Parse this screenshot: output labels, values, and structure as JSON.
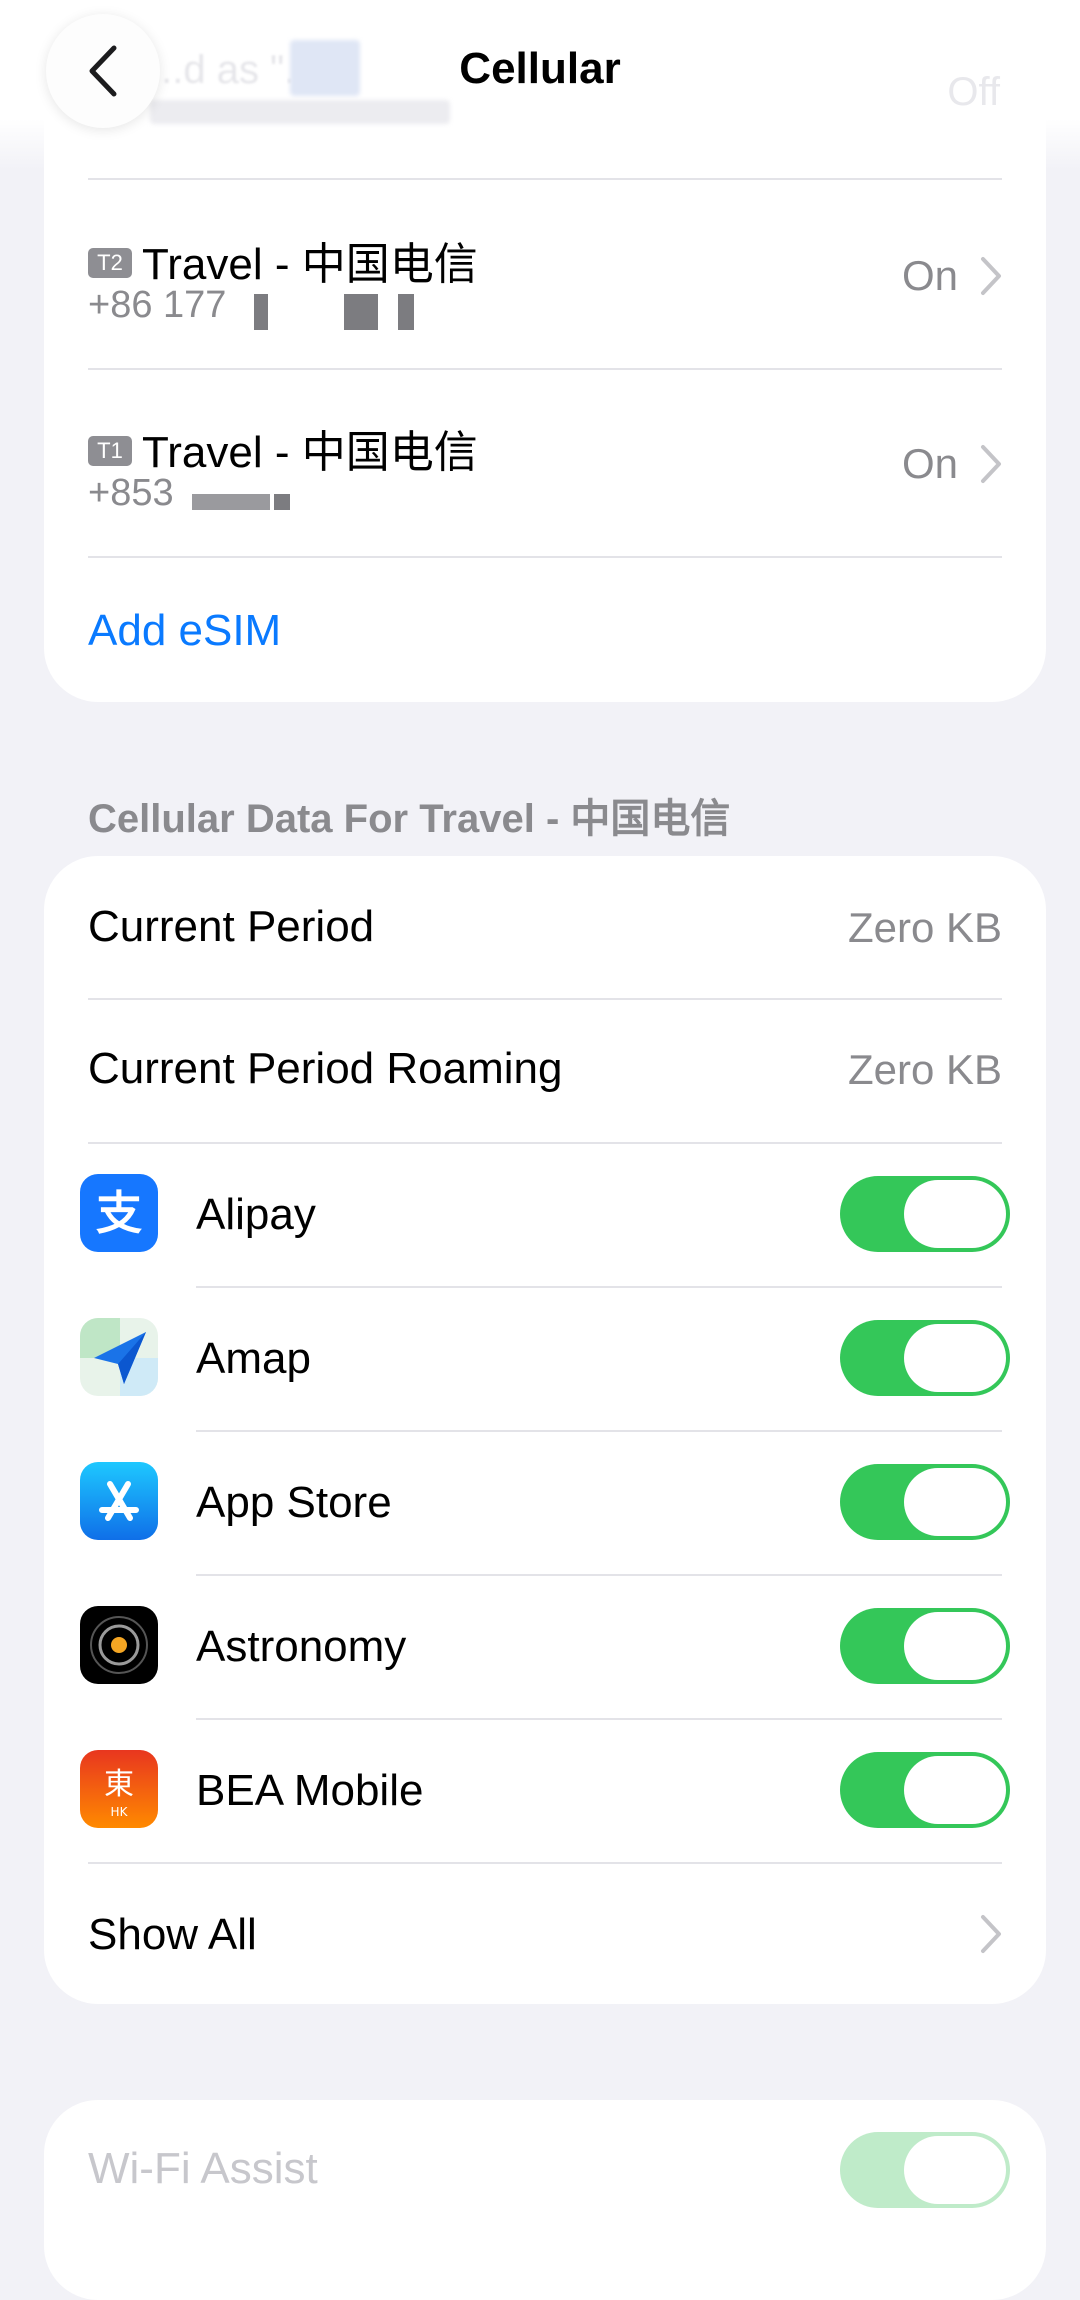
{
  "nav": {
    "title": "Cellular",
    "faded_row_text": "...d as \"...\"",
    "faded_row_value": "Off"
  },
  "sims": [
    {
      "badge": "T2",
      "name": "Travel - 中国电信",
      "number": "+86 177",
      "value": "On"
    },
    {
      "badge": "T1",
      "name": "Travel - 中国电信",
      "number": "+853",
      "value": "On"
    }
  ],
  "add_esim_label": "Add eSIM",
  "data_section": {
    "header": "Cellular Data For Travel - 中国电信",
    "current_period": {
      "label": "Current Period",
      "value": "Zero KB"
    },
    "current_period_roaming": {
      "label": "Current Period Roaming",
      "value": "Zero KB"
    },
    "apps": [
      {
        "name": "Alipay",
        "icon": "alipay-icon",
        "enabled": true
      },
      {
        "name": "Amap",
        "icon": "amap-icon",
        "enabled": true
      },
      {
        "name": "App Store",
        "icon": "app-store-icon",
        "enabled": true
      },
      {
        "name": "Astronomy",
        "icon": "astronomy-icon",
        "enabled": true
      },
      {
        "name": "BEA Mobile",
        "icon": "bea-mobile-icon",
        "enabled": true
      }
    ],
    "show_all_label": "Show All"
  },
  "wifi_assist": {
    "label": "Wi-Fi Assist",
    "enabled": true
  },
  "colors": {
    "accent": "#0a7aff",
    "toggle_on": "#34c759",
    "background": "#f2f2f7",
    "secondary_text": "#8a8a8e"
  }
}
